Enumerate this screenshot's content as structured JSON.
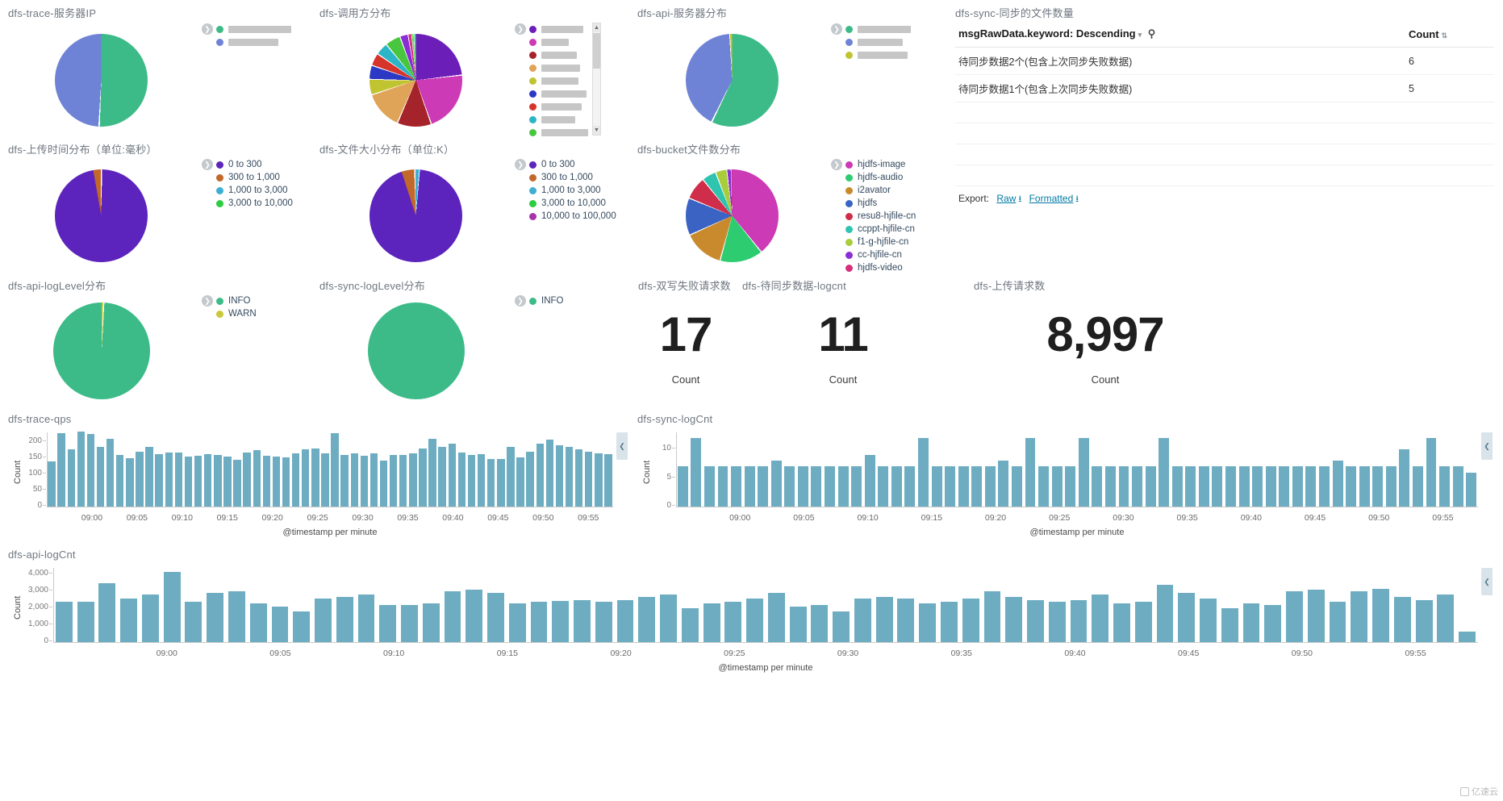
{
  "panels": {
    "trace_server_ip": {
      "title": "dfs-trace-服务器IP"
    },
    "caller_dist": {
      "title": "dfs-调用方分布"
    },
    "api_server_dist": {
      "title": "dfs-api-服务器分布"
    },
    "sync_file_count": {
      "title": "dfs-sync-同步的文件数量"
    },
    "upload_time": {
      "title": "dfs-上传时间分布（单位:毫秒）"
    },
    "file_size": {
      "title": "dfs-文件大小分布（单位:K）"
    },
    "bucket_files": {
      "title": "dfs-bucket文件数分布"
    },
    "api_loglevel": {
      "title": "dfs-api-logLevel分布"
    },
    "sync_loglevel": {
      "title": "dfs-sync-logLevel分布"
    },
    "dual_write_fail": {
      "title": "dfs-双写失败请求数"
    },
    "pending_sync": {
      "title": "dfs-待同步数据-logcnt"
    },
    "upload_requests": {
      "title": "dfs-上传请求数"
    },
    "trace_qps": {
      "title": "dfs-trace-qps"
    },
    "sync_logcnt": {
      "title": "dfs-sync-logCnt"
    },
    "api_logcnt": {
      "title": "dfs-api-logCnt"
    }
  },
  "legend_toggle_icon": "chevron-right-icon",
  "table": {
    "columns": [
      "msgRawData.keyword: Descending",
      "Count"
    ],
    "header_icons": [
      "caret-down-icon",
      "search-icon",
      "sort-icon"
    ],
    "rows": [
      {
        "key": "待同步数据2个(包含上次同步失败数据)",
        "count": "6"
      },
      {
        "key": "待同步数据1个(包含上次同步失败数据)",
        "count": "5"
      }
    ],
    "empty_rows": 4,
    "export": {
      "label": "Export:",
      "raw": "Raw",
      "formatted": "Formatted",
      "download_icon": "download-icon"
    }
  },
  "metrics": [
    {
      "name": "dual-write-fail",
      "value": "17",
      "label": "Count"
    },
    {
      "name": "pending-sync",
      "value": "11",
      "label": "Count"
    },
    {
      "name": "upload-requests",
      "value": "8,997",
      "label": "Count"
    }
  ],
  "colors": {
    "pie_green": "#3cbb88",
    "pie_blue": "#6f83d6",
    "pie_purple": "#5c23bd",
    "pie_orange": "#c1682a",
    "pie_cyan": "#3eaed4",
    "pie_magenta": "#cc3ab5",
    "bar_blue": "#6eadc1",
    "warn_yellow": "#c9c93b",
    "link": "#0079a5"
  },
  "watermark": {
    "text": "亿速云"
  },
  "chart_data": [
    {
      "name": "trace-server-ip",
      "type": "pie",
      "title": "dfs-trace-服务器IP",
      "legend_position": "right",
      "redacted_labels": true,
      "slices": [
        {
          "label": "",
          "redacted": true,
          "redact_width": 78,
          "value": 50.5,
          "color": "#3cbb88"
        },
        {
          "label": "",
          "redacted": true,
          "redact_width": 62,
          "value": 49.5,
          "color": "#6f83d6"
        }
      ]
    },
    {
      "name": "caller-distribution",
      "type": "pie",
      "title": "dfs-调用方分布",
      "legend_position": "right",
      "legend_scroll": true,
      "redacted_labels": true,
      "slices": [
        {
          "label": "",
          "redacted": true,
          "redact_width": 52,
          "value": 23.0,
          "color": "#6b1fb8"
        },
        {
          "label": "",
          "redacted": true,
          "redact_width": 34,
          "value": 21.0,
          "color": "#cc3ab5"
        },
        {
          "label": "",
          "redacted": true,
          "redact_width": 44,
          "value": 11.5,
          "color": "#a5232a"
        },
        {
          "label": "",
          "redacted": true,
          "redact_width": 48,
          "value": 13.0,
          "color": "#e0a458"
        },
        {
          "label": "",
          "redacted": true,
          "redact_width": 46,
          "value": 5.0,
          "color": "#c1c431"
        },
        {
          "label": "",
          "redacted": true,
          "redact_width": 56,
          "value": 4.5,
          "color": "#2b39c4"
        },
        {
          "label": "",
          "redacted": true,
          "redact_width": 50,
          "value": 4.0,
          "color": "#d6342a"
        },
        {
          "label": "",
          "redacted": true,
          "redact_width": 42,
          "value": 4.0,
          "color": "#2bb5c6"
        },
        {
          "label": "",
          "redacted": true,
          "redact_width": 58,
          "value": 5.0,
          "color": "#49c63f"
        },
        {
          "label": "",
          "redacted": true,
          "redact_width": 40,
          "value": 2.5,
          "color": "#8a2fd4"
        },
        {
          "label": "",
          "redacted": true,
          "redact_width": 40,
          "value": 2.0,
          "color": "#d62f8a"
        },
        {
          "label": "",
          "redacted": true,
          "redact_width": 40,
          "value": 2.0,
          "color": "#7bd43f"
        },
        {
          "label": "",
          "redacted": true,
          "redact_width": 40,
          "value": 1.5,
          "color": "#3fd4a0"
        },
        {
          "label": "",
          "redacted": true,
          "redact_width": 40,
          "value": 1.0,
          "color": "#d4a03f"
        }
      ]
    },
    {
      "name": "api-server-distribution",
      "type": "pie",
      "title": "dfs-api-服务器分布",
      "legend_position": "right",
      "redacted_labels": true,
      "slices": [
        {
          "label": "",
          "redacted": true,
          "redact_width": 66,
          "value": 57.0,
          "color": "#3cbb88"
        },
        {
          "label": "",
          "redacted": true,
          "redact_width": 56,
          "value": 42.0,
          "color": "#6f83d6"
        },
        {
          "label": "",
          "redacted": true,
          "redact_width": 62,
          "value": 1.0,
          "color": "#c1c431"
        }
      ]
    },
    {
      "name": "upload-time-distribution",
      "type": "pie",
      "title": "dfs-上传时间分布（单位:毫秒）",
      "legend_position": "right",
      "xlabel": "",
      "ylabel": "",
      "slices": [
        {
          "label": "0 to 300",
          "value": 97.0,
          "color": "#5c23bd"
        },
        {
          "label": "300 to 1,000",
          "value": 2.6,
          "color": "#c1682a"
        },
        {
          "label": "1,000 to 3,000",
          "value": 0.3,
          "color": "#3eaed4"
        },
        {
          "label": "3,000 to 10,000",
          "value": 0.1,
          "color": "#2ecc40"
        }
      ]
    },
    {
      "name": "file-size-distribution",
      "type": "pie",
      "title": "dfs-文件大小分布（单位:K）",
      "legend_position": "right",
      "slices": [
        {
          "label": "0 to 300",
          "value": 94.0,
          "color": "#5c23bd"
        },
        {
          "label": "300 to 1,000",
          "value": 4.4,
          "color": "#c1682a"
        },
        {
          "label": "1,000 to 3,000",
          "value": 1.3,
          "color": "#3eaed4"
        },
        {
          "label": "3,000 to 10,000",
          "value": 0.2,
          "color": "#2ecc40"
        },
        {
          "label": "10,000 to 100,000",
          "value": 0.1,
          "color": "#a832a8"
        }
      ]
    },
    {
      "name": "bucket-file-distribution",
      "type": "pie",
      "title": "dfs-bucket文件数分布",
      "legend_position": "right",
      "slices": [
        {
          "label": "hjdfs-image",
          "value": 39.0,
          "color": "#cc3ab5"
        },
        {
          "label": "hjdfs-audio",
          "value": 15.0,
          "color": "#2ecc71"
        },
        {
          "label": "i2avator",
          "value": 14.0,
          "color": "#c98a2e"
        },
        {
          "label": "hjdfs",
          "value": 13.0,
          "color": "#3b63c4"
        },
        {
          "label": "resu8-hjfile-cn",
          "value": 8.0,
          "color": "#cf2d4a"
        },
        {
          "label": "ccppt-hjfile-cn",
          "value": 5.0,
          "color": "#2ec4b0"
        },
        {
          "label": "f1-g-hjfile-cn",
          "value": 4.0,
          "color": "#a8cc3a"
        },
        {
          "label": "cc-hjfile-cn",
          "value": 1.5,
          "color": "#8a2fd4"
        },
        {
          "label": "hjdfs-video",
          "value": 0.5,
          "color": "#d62f7a"
        }
      ]
    },
    {
      "name": "api-loglevel-distribution",
      "type": "pie",
      "title": "dfs-api-logLevel分布",
      "legend_position": "right",
      "slices": [
        {
          "label": "INFO",
          "value": 99.5,
          "color": "#3cbb88"
        },
        {
          "label": "WARN",
          "value": 0.5,
          "color": "#c9c93b"
        }
      ]
    },
    {
      "name": "sync-loglevel-distribution",
      "type": "pie",
      "title": "dfs-sync-logLevel分布",
      "legend_position": "right",
      "slices": [
        {
          "label": "INFO",
          "value": 100,
          "color": "#3cbb88"
        }
      ]
    },
    {
      "name": "trace-qps",
      "type": "bar",
      "title": "dfs-trace-qps",
      "xlabel": "@timestamp per minute",
      "ylabel": "Count",
      "yticks": [
        "0",
        "50",
        "100",
        "150",
        "200"
      ],
      "ylim": [
        0,
        230
      ],
      "xticks": [
        "09:00",
        "09:05",
        "09:10",
        "09:15",
        "09:20",
        "09:25",
        "09:30",
        "09:35",
        "09:40",
        "09:45",
        "09:50",
        "09:55"
      ],
      "values": [
        140,
        228,
        178,
        232,
        226,
        184,
        210,
        160,
        150,
        170,
        186,
        162,
        168,
        168,
        156,
        158,
        162,
        160,
        154,
        146,
        168,
        176,
        158,
        154,
        152,
        166,
        178,
        180,
        166,
        228,
        160,
        166,
        158,
        166,
        142,
        160,
        160,
        164,
        180,
        210,
        186,
        196,
        168,
        160,
        162,
        148,
        148,
        186,
        152,
        170,
        196,
        208,
        190,
        186,
        178,
        170,
        166,
        162
      ]
    },
    {
      "name": "sync-logcnt",
      "type": "bar",
      "title": "dfs-sync-logCnt",
      "xlabel": "@timestamp per minute",
      "ylabel": "Count",
      "yticks": [
        "0",
        "5",
        "10"
      ],
      "ylim": [
        0,
        13
      ],
      "xticks": [
        "09:00",
        "09:05",
        "09:10",
        "09:15",
        "09:20",
        "09:25",
        "09:30",
        "09:35",
        "09:40",
        "09:45",
        "09:50",
        "09:55"
      ],
      "values": [
        7,
        12,
        7,
        7,
        7,
        7,
        7,
        8,
        7,
        7,
        7,
        7,
        7,
        7,
        9,
        7,
        7,
        7,
        12,
        7,
        7,
        7,
        7,
        7,
        8,
        7,
        12,
        7,
        7,
        7,
        12,
        7,
        7,
        7,
        7,
        7,
        12,
        7,
        7,
        7,
        7,
        7,
        7,
        7,
        7,
        7,
        7,
        7,
        7,
        8,
        7,
        7,
        7,
        7,
        10,
        7,
        12,
        7,
        7,
        6
      ]
    },
    {
      "name": "api-logcnt",
      "type": "bar",
      "title": "dfs-api-logCnt",
      "xlabel": "@timestamp per minute",
      "ylabel": "Count",
      "yticks": [
        "0",
        "1,000",
        "2,000",
        "3,000",
        "4,000"
      ],
      "ylim": [
        0,
        4400
      ],
      "xticks": [
        "09:00",
        "09:05",
        "09:10",
        "09:15",
        "09:20",
        "09:25",
        "09:30",
        "09:35",
        "09:40",
        "09:45",
        "09:50",
        "09:55"
      ],
      "values": [
        2400,
        2400,
        3500,
        2600,
        2800,
        4150,
        2400,
        2900,
        3000,
        2300,
        2100,
        1800,
        2600,
        2700,
        2800,
        2200,
        2200,
        2300,
        3000,
        3100,
        2900,
        2300,
        2400,
        2450,
        2500,
        2400,
        2500,
        2700,
        2800,
        2000,
        2300,
        2400,
        2600,
        2900,
        2100,
        2200,
        1800,
        2600,
        2700,
        2600,
        2300,
        2400,
        2600,
        3000,
        2700,
        2500,
        2400,
        2500,
        2800,
        2300,
        2400,
        3400,
        2900,
        2600,
        2000,
        2300,
        2200,
        3000,
        3100,
        2400,
        3000,
        3150,
        2700,
        2500,
        2800,
        600
      ]
    }
  ]
}
